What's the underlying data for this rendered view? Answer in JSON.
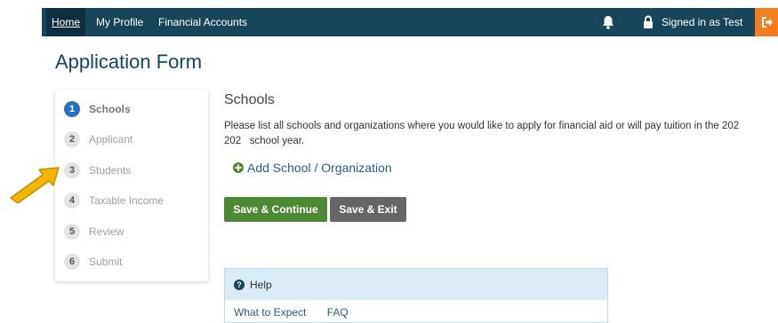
{
  "nav": {
    "home": "Home",
    "my_profile": "My Profile",
    "financial_accounts": "Financial Accounts",
    "signed_in": "Signed in as Test"
  },
  "page": {
    "title": "Application Form"
  },
  "steps": [
    {
      "num": "1",
      "label": "Schools"
    },
    {
      "num": "2",
      "label": "Applicant"
    },
    {
      "num": "3",
      "label": "Students"
    },
    {
      "num": "4",
      "label": "Taxable Income"
    },
    {
      "num": "5",
      "label": "Review"
    },
    {
      "num": "6",
      "label": "Submit"
    }
  ],
  "main": {
    "section_title": "Schools",
    "instructions_line1": "Please list all schools and organizations where you would like to apply for financial aid or will pay tuition in the 202",
    "instructions_line2": "202   school year.",
    "add_school": "Add School / Organization",
    "save_continue": "Save & Continue",
    "save_exit": "Save & Exit"
  },
  "help": {
    "title": "Help",
    "links": [
      "What to Expect",
      "FAQ"
    ]
  },
  "colors": {
    "navbar": "#16455c",
    "accent_orange": "#f47d20",
    "active_step": "#2a6ebf",
    "continue_button": "#4d8a36",
    "exit_button": "#666666",
    "arrow": "#f4b400"
  },
  "icons": [
    "bell-icon",
    "lock-icon",
    "logout-icon",
    "plus-circle-icon",
    "question-circle-icon",
    "pointer-arrow"
  ]
}
